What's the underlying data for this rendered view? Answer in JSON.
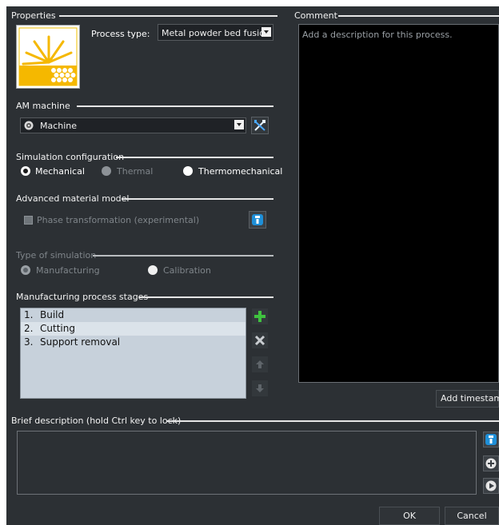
{
  "properties": {
    "title": "Properties",
    "process_type_label": "Process type:",
    "process_type_value": "Metal powder bed fusion",
    "process_icon": "metal-powder-bed-fusion-icon"
  },
  "am_machine": {
    "title": "AM machine",
    "selected": "Machine",
    "machine_icon": "machine-icon",
    "tools_icon": "tools-icon"
  },
  "simulation_configuration": {
    "title": "Simulation configuration",
    "options": [
      {
        "label": "Mechanical",
        "selected": true,
        "enabled": true
      },
      {
        "label": "Thermal",
        "selected": false,
        "enabled": false
      },
      {
        "label": "Thermomechanical",
        "selected": false,
        "enabled": true
      }
    ]
  },
  "advanced_material_model": {
    "title": "Advanced material model",
    "checkbox_label": "Phase transformation (experimental)",
    "checked": false,
    "enabled": false
  },
  "type_of_simulation": {
    "title": "Type of simulation",
    "enabled": false,
    "options": [
      {
        "label": "Manufacturing",
        "selected": true
      },
      {
        "label": "Calibration",
        "selected": false
      }
    ]
  },
  "manufacturing_stages": {
    "title": "Manufacturing process stages",
    "items": [
      {
        "number": "1.",
        "label": "Build"
      },
      {
        "number": "2.",
        "label": "Cutting"
      },
      {
        "number": "3.",
        "label": "Support removal"
      }
    ],
    "selected_index": 1
  },
  "comment": {
    "title": "Comment",
    "placeholder": "Add a description for this process.",
    "add_timestamp_label": "Add timestamp"
  },
  "brief_description": {
    "title": "Brief description (hold Ctrl key to lock)"
  },
  "footer": {
    "ok_label": "OK",
    "cancel_label": "Cancel"
  },
  "colors": {
    "background": "#2c3034",
    "accent_green": "#3fc23f",
    "info_blue": "#1e8fd8",
    "icon_yellow": "#f5b800"
  }
}
